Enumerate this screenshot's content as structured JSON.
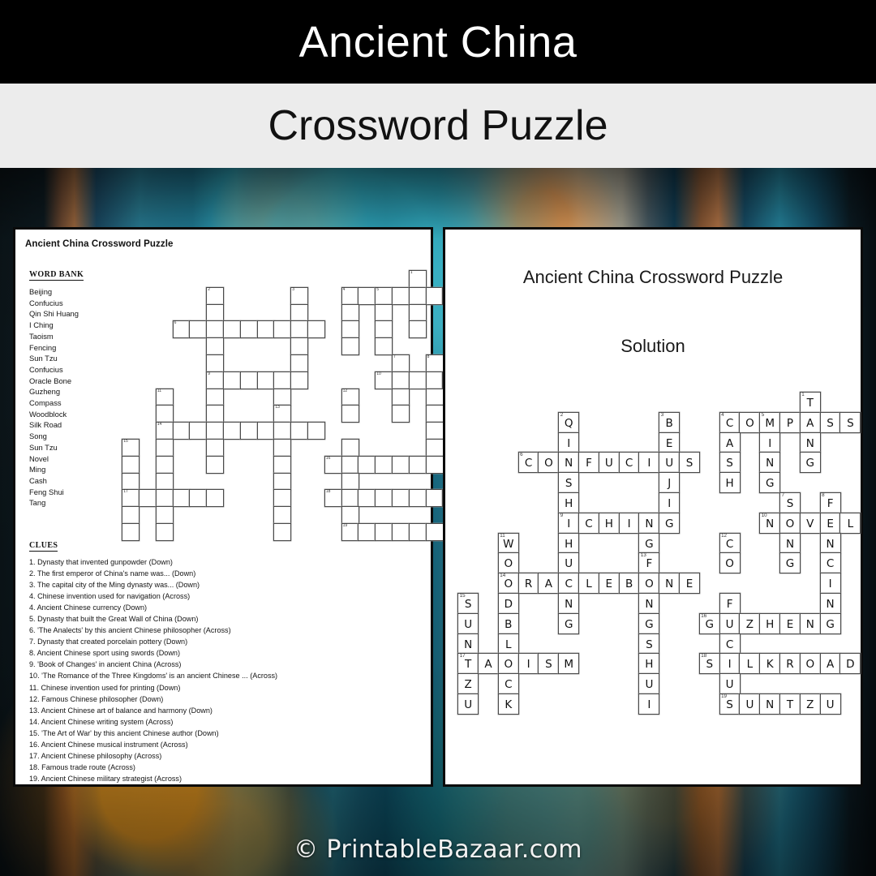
{
  "header": {
    "title": "Ancient China",
    "subtitle": "Crossword Puzzle"
  },
  "footer": {
    "credit": "© PrintableBazaar.com"
  },
  "puzzle_panel": {
    "title": "Ancient China Crossword Puzzle",
    "word_bank_heading": "WORD BANK",
    "word_bank": [
      "Beijing",
      "Confucius",
      "Qin Shi Huang",
      "I Ching",
      "Taoism",
      "Fencing",
      "Sun Tzu",
      "Confucius",
      "Oracle Bone",
      "Guzheng",
      "Compass",
      "Woodblock",
      "Silk Road",
      "Song",
      "Sun Tzu",
      "Novel",
      "Ming",
      "Cash",
      "Feng Shui",
      "Tang"
    ],
    "clues_heading": "CLUES",
    "clues": [
      "1. Dynasty that invented gunpowder  (Down)",
      "2. The first emperor  of China's name was... (Down)",
      "3. The capital city of the Ming dynasty was... (Down)",
      "4. Chinese invention used for navigation (Across)",
      "4. Ancient Chinese currency  (Down)",
      "5. Dynasty that built the  Great Wall of China (Down)",
      "6. 'The Analects' by this ancient Chinese philosopher  (Across)",
      "7. Dynasty that created porcelain pottery  (Down)",
      "8. Ancient Chinese sport using swords (Down)",
      "9. 'Book of Changes' in ancient China (Across)",
      "10. 'The Romance of the Three Kingdoms' is an ancient Chinese ...  (Across)",
      "11. Chinese invention used for printing (Down)",
      "12. Famous Chinese philosopher (Down)",
      "13. Ancient Chinese art of balance and harmony (Down)",
      "14. Ancient Chinese writing system (Across)",
      "15. 'The Art of War' by this ancient Chinese author (Down)",
      "16. Ancient Chinese musical instrument (Across)",
      "17. Ancient Chinese philosophy (Across)",
      "18. Famous trade route  (Across)",
      "19. Ancient Chinese military strategist (Across)"
    ]
  },
  "solution_panel": {
    "title": "Ancient China Crossword Puzzle",
    "subtitle": "Solution"
  },
  "chart_data": {
    "type": "table",
    "title": "Ancient China Crossword Puzzle grid",
    "grid_columns": 22,
    "grid_rows": 17,
    "entries": [
      {
        "number": 1,
        "direction": "Down",
        "answer": "TANG",
        "clue": "Dynasty that invented gunpowder",
        "col": 16,
        "row": 0
      },
      {
        "number": 2,
        "direction": "Down",
        "answer": "QINSHIHUANG",
        "clue": "The first emperor of China's name was...",
        "col": 4,
        "row": 1
      },
      {
        "number": 3,
        "direction": "Down",
        "answer": "BEIJING",
        "clue": "The capital city of the Ming dynasty was...",
        "col": 9,
        "row": 1
      },
      {
        "number": 4,
        "direction": "Across",
        "answer": "COMPASS",
        "clue": "Chinese invention used for navigation",
        "col": 12,
        "row": 1
      },
      {
        "number": 4,
        "direction": "Down",
        "answer": "CASH",
        "clue": "Ancient Chinese currency",
        "col": 12,
        "row": 1
      },
      {
        "number": 5,
        "direction": "Down",
        "answer": "MING",
        "clue": "Dynasty that built the Great Wall of China",
        "col": 14,
        "row": 1
      },
      {
        "number": 6,
        "direction": "Across",
        "answer": "CONFUCIUS",
        "clue": "'The Analects' by this ancient Chinese philosopher",
        "col": 2,
        "row": 3
      },
      {
        "number": 7,
        "direction": "Down",
        "answer": "SONG",
        "clue": "Dynasty that created porcelain pottery",
        "col": 15,
        "row": 5
      },
      {
        "number": 8,
        "direction": "Down",
        "answer": "FENCING",
        "clue": "Ancient Chinese sport using swords",
        "col": 17,
        "row": 5
      },
      {
        "number": 9,
        "direction": "Across",
        "answer": "ICHING",
        "clue": "'Book of Changes' in ancient China",
        "col": 4,
        "row": 6
      },
      {
        "number": 10,
        "direction": "Across",
        "answer": "NOVEL",
        "clue": "'The Romance of the Three Kingdoms' is an ancient Chinese ...",
        "col": 14,
        "row": 6
      },
      {
        "number": 11,
        "direction": "Down",
        "answer": "WOODBLOCK",
        "clue": "Chinese invention used for printing",
        "col": 1,
        "row": 7
      },
      {
        "number": 12,
        "direction": "Down",
        "answer": "CONFUCIUS",
        "clue": "Famous Chinese philosopher",
        "col": 12,
        "row": 7
      },
      {
        "number": 13,
        "direction": "Down",
        "answer": "FENGSHUI",
        "clue": "Ancient Chinese art of balance and harmony",
        "col": 8,
        "row": 8
      },
      {
        "number": 14,
        "direction": "Across",
        "answer": "ORACLEBONE",
        "clue": "Ancient Chinese writing system",
        "col": 1,
        "row": 9
      },
      {
        "number": 15,
        "direction": "Down",
        "answer": "SUNTZU",
        "clue": "'The Art of War' by this ancient Chinese author",
        "col": -1,
        "row": 10
      },
      {
        "number": 16,
        "direction": "Across",
        "answer": "GUZHENG",
        "clue": "Ancient Chinese musical instrument",
        "col": 11,
        "row": 11
      },
      {
        "number": 17,
        "direction": "Across",
        "answer": "TAOISM",
        "clue": "Ancient Chinese philosophy",
        "col": -1,
        "row": 13
      },
      {
        "number": 18,
        "direction": "Across",
        "answer": "SILKROAD",
        "clue": "Famous trade route",
        "col": 11,
        "row": 13
      },
      {
        "number": 19,
        "direction": "Across",
        "answer": "SUNTZU",
        "clue": "Ancient Chinese military strategist",
        "col": 12,
        "row": 15
      }
    ],
    "cells": [
      {
        "c": 16,
        "r": 0,
        "l": "T",
        "n": 1
      },
      {
        "c": 4,
        "r": 1,
        "l": "Q",
        "n": 2
      },
      {
        "c": 9,
        "r": 1,
        "l": "B",
        "n": 3
      },
      {
        "c": 12,
        "r": 1,
        "l": "C",
        "n": 4
      },
      {
        "c": 13,
        "r": 1,
        "l": "O"
      },
      {
        "c": 14,
        "r": 1,
        "l": "M",
        "n": 5
      },
      {
        "c": 15,
        "r": 1,
        "l": "P"
      },
      {
        "c": 16,
        "r": 1,
        "l": "A"
      },
      {
        "c": 17,
        "r": 1,
        "l": "S"
      },
      {
        "c": 18,
        "r": 1,
        "l": "S"
      },
      {
        "c": 4,
        "r": 2,
        "l": "I"
      },
      {
        "c": 9,
        "r": 2,
        "l": "E"
      },
      {
        "c": 12,
        "r": 2,
        "l": "A"
      },
      {
        "c": 14,
        "r": 2,
        "l": "I"
      },
      {
        "c": 16,
        "r": 2,
        "l": "N"
      },
      {
        "c": 2,
        "r": 3,
        "l": "C",
        "n": 6
      },
      {
        "c": 3,
        "r": 3,
        "l": "O"
      },
      {
        "c": 4,
        "r": 3,
        "l": "N"
      },
      {
        "c": 5,
        "r": 3,
        "l": "F"
      },
      {
        "c": 6,
        "r": 3,
        "l": "U"
      },
      {
        "c": 7,
        "r": 3,
        "l": "C"
      },
      {
        "c": 8,
        "r": 3,
        "l": "I"
      },
      {
        "c": 9,
        "r": 3,
        "l": "U"
      },
      {
        "c": 10,
        "r": 3,
        "l": "S"
      },
      {
        "c": 12,
        "r": 3,
        "l": "S"
      },
      {
        "c": 14,
        "r": 3,
        "l": "N"
      },
      {
        "c": 16,
        "r": 3,
        "l": "G"
      },
      {
        "c": 4,
        "r": 4,
        "l": "S"
      },
      {
        "c": 9,
        "r": 4,
        "l": "J"
      },
      {
        "c": 12,
        "r": 4,
        "l": "H"
      },
      {
        "c": 14,
        "r": 4,
        "l": "G"
      },
      {
        "c": 4,
        "r": 5,
        "l": "H"
      },
      {
        "c": 9,
        "r": 5,
        "l": "I"
      },
      {
        "c": 15,
        "r": 5,
        "l": "S",
        "n": 7
      },
      {
        "c": 17,
        "r": 5,
        "l": "F",
        "n": 8
      },
      {
        "c": 4,
        "r": 6,
        "l": "I",
        "n": 9
      },
      {
        "c": 5,
        "r": 6,
        "l": "C"
      },
      {
        "c": 6,
        "r": 6,
        "l": "H"
      },
      {
        "c": 7,
        "r": 6,
        "l": "I"
      },
      {
        "c": 8,
        "r": 6,
        "l": "N"
      },
      {
        "c": 9,
        "r": 6,
        "l": "G"
      },
      {
        "c": 14,
        "r": 6,
        "l": "N",
        "n": 10
      },
      {
        "c": 15,
        "r": 6,
        "l": "O"
      },
      {
        "c": 16,
        "r": 6,
        "l": "V"
      },
      {
        "c": 17,
        "r": 6,
        "l": "E"
      },
      {
        "c": 18,
        "r": 6,
        "l": "L"
      },
      {
        "c": 1,
        "r": 7,
        "l": "W",
        "n": 11
      },
      {
        "c": 4,
        "r": 7,
        "l": "H"
      },
      {
        "c": 8,
        "r": 7,
        "l": "G"
      },
      {
        "c": 12,
        "r": 7,
        "l": "C",
        "n": 12
      },
      {
        "c": 15,
        "r": 7,
        "l": "N"
      },
      {
        "c": 17,
        "r": 7,
        "l": "N"
      },
      {
        "c": 1,
        "r": 8,
        "l": "O"
      },
      {
        "c": 4,
        "r": 8,
        "l": "U"
      },
      {
        "c": 8,
        "r": 8,
        "l": "F",
        "n": 13
      },
      {
        "c": 12,
        "r": 8,
        "l": "O"
      },
      {
        "c": 15,
        "r": 8,
        "l": "G"
      },
      {
        "c": 17,
        "r": 8,
        "l": "C"
      },
      {
        "c": 1,
        "r": 9,
        "l": "O",
        "n": 14
      },
      {
        "c": 2,
        "r": 9,
        "l": "R"
      },
      {
        "c": 3,
        "r": 9,
        "l": "A"
      },
      {
        "c": 4,
        "r": 9,
        "l": "C"
      },
      {
        "c": 5,
        "r": 9,
        "l": "L"
      },
      {
        "c": 6,
        "r": 9,
        "l": "E"
      },
      {
        "c": 7,
        "r": 9,
        "l": "B"
      },
      {
        "c": 8,
        "r": 9,
        "l": "O"
      },
      {
        "c": 9,
        "r": 9,
        "l": "N"
      },
      {
        "c": 10,
        "r": 9,
        "l": "E"
      },
      {
        "c": 17,
        "r": 9,
        "l": "I"
      },
      {
        "c": -1,
        "r": 10,
        "l": "S",
        "n": 15
      },
      {
        "c": 1,
        "r": 10,
        "l": "D"
      },
      {
        "c": 4,
        "r": 10,
        "l": "N"
      },
      {
        "c": 8,
        "r": 10,
        "l": "N"
      },
      {
        "c": 12,
        "r": 10,
        "l": "F"
      },
      {
        "c": 17,
        "r": 10,
        "l": "N"
      },
      {
        "c": -1,
        "r": 11,
        "l": "U"
      },
      {
        "c": 1,
        "r": 11,
        "l": "B"
      },
      {
        "c": 4,
        "r": 11,
        "l": "G"
      },
      {
        "c": 8,
        "r": 11,
        "l": "G"
      },
      {
        "c": 11,
        "r": 11,
        "l": "G",
        "n": 16
      },
      {
        "c": 12,
        "r": 11,
        "l": "U"
      },
      {
        "c": 13,
        "r": 11,
        "l": "Z"
      },
      {
        "c": 14,
        "r": 11,
        "l": "H"
      },
      {
        "c": 15,
        "r": 11,
        "l": "E"
      },
      {
        "c": 16,
        "r": 11,
        "l": "N"
      },
      {
        "c": 17,
        "r": 11,
        "l": "G"
      },
      {
        "c": -1,
        "r": 12,
        "l": "N"
      },
      {
        "c": 1,
        "r": 12,
        "l": "L"
      },
      {
        "c": 8,
        "r": 12,
        "l": "S"
      },
      {
        "c": 12,
        "r": 12,
        "l": "C"
      },
      {
        "c": -1,
        "r": 13,
        "l": "T",
        "n": 17
      },
      {
        "c": 0,
        "r": 13,
        "l": "A"
      },
      {
        "c": 1,
        "r": 13,
        "l": "O"
      },
      {
        "c": 2,
        "r": 13,
        "l": "I"
      },
      {
        "c": 3,
        "r": 13,
        "l": "S"
      },
      {
        "c": 4,
        "r": 13,
        "l": "M"
      },
      {
        "c": 8,
        "r": 13,
        "l": "H"
      },
      {
        "c": 11,
        "r": 13,
        "l": "S",
        "n": 18
      },
      {
        "c": 12,
        "r": 13,
        "l": "I"
      },
      {
        "c": 13,
        "r": 13,
        "l": "L"
      },
      {
        "c": 14,
        "r": 13,
        "l": "K"
      },
      {
        "c": 15,
        "r": 13,
        "l": "R"
      },
      {
        "c": 16,
        "r": 13,
        "l": "O"
      },
      {
        "c": 17,
        "r": 13,
        "l": "A"
      },
      {
        "c": 18,
        "r": 13,
        "l": "D"
      },
      {
        "c": -1,
        "r": 14,
        "l": "Z"
      },
      {
        "c": 1,
        "r": 14,
        "l": "C"
      },
      {
        "c": 8,
        "r": 14,
        "l": "U"
      },
      {
        "c": 12,
        "r": 14,
        "l": "U"
      },
      {
        "c": -1,
        "r": 15,
        "l": "U"
      },
      {
        "c": 1,
        "r": 15,
        "l": "K"
      },
      {
        "c": 8,
        "r": 15,
        "l": "I"
      },
      {
        "c": 12,
        "r": 15,
        "l": "S",
        "n": 19
      },
      {
        "c": 13,
        "r": 15,
        "l": "U"
      },
      {
        "c": 14,
        "r": 15,
        "l": "N"
      },
      {
        "c": 15,
        "r": 15,
        "l": "T"
      },
      {
        "c": 16,
        "r": 15,
        "l": "Z"
      },
      {
        "c": 17,
        "r": 15,
        "l": "U"
      }
    ]
  }
}
